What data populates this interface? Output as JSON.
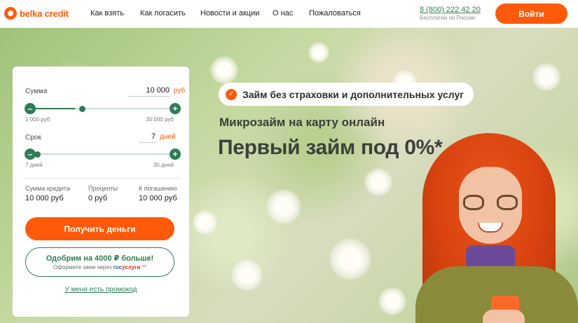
{
  "brand": {
    "name": "belka credit"
  },
  "nav": {
    "items": [
      "Как взять",
      "Как погасить",
      "Новости и акции",
      "О нас",
      "Пожаловаться"
    ]
  },
  "contact": {
    "phone": "8 (800) 222 42 20",
    "note": "Бесплатно по России"
  },
  "header": {
    "login_label": "Войти"
  },
  "hero": {
    "pill_text": "Займ без страховки и дополнительных услуг",
    "subtitle": "Микрозайм на карту онлайн",
    "headline": "Первый займ под 0%*"
  },
  "calculator": {
    "amount": {
      "label": "Сумма",
      "value": "10 000",
      "unit": "руб",
      "min": "1 000 руб",
      "max": "30 000 руб",
      "fraction": 0.31
    },
    "term": {
      "label": "Срок",
      "value": "7",
      "unit": "дней",
      "min": "7 дней",
      "max": "30 дней",
      "fraction": 0.0
    },
    "summary": [
      {
        "label": "Сумма кредита",
        "value": "10 000 руб"
      },
      {
        "label": "Проценты",
        "value": "0 руб"
      },
      {
        "label": "К погашению",
        "value": "10 000 руб"
      }
    ],
    "submit_label": "Получить деньги",
    "gos": {
      "title": "Одобрим на 4000 ₽ больше!",
      "sub_prefix": "Оформите заем через",
      "brand_a": "гос",
      "brand_b": "услуги",
      "suffix": "**"
    },
    "promo_label": "У меня есть промокод"
  },
  "colors": {
    "accent": "#ff5a0a",
    "green": "#2e7d55"
  },
  "icons": {
    "pill": "check-icon",
    "slider_minus": "minus-icon",
    "slider_plus": "plus-icon",
    "logo": "squirrel-logo-icon"
  }
}
